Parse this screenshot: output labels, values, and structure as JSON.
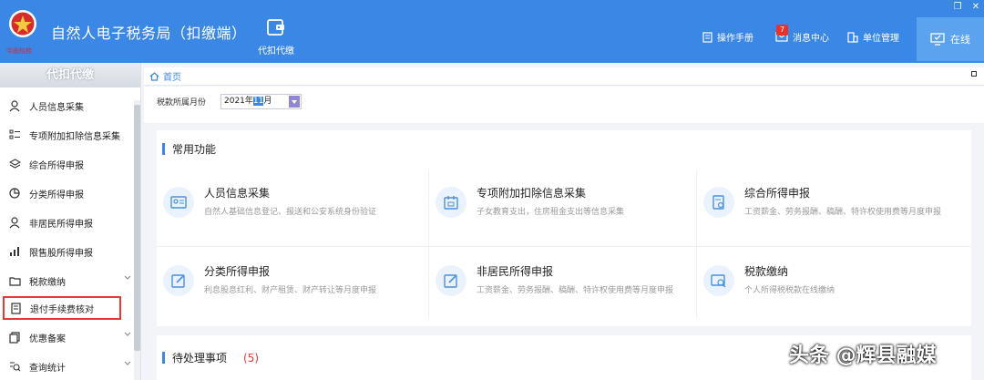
{
  "app": {
    "title": "自然人电子税务局（扣缴端）",
    "logo_text": "中國稅務"
  },
  "top_tab": {
    "label": "代扣代缴",
    "icon": "wallet-icon"
  },
  "topnav": {
    "manual": "操作手册",
    "messages": "消息中心",
    "message_count": "7",
    "unit": "单位管理",
    "online": "在线"
  },
  "sidebar": {
    "header": "代扣代缴",
    "items": [
      {
        "label": "人员信息采集",
        "icon": "person-icon"
      },
      {
        "label": "专项附加扣除信息采集",
        "icon": "list-icon"
      },
      {
        "label": "综合所得申报",
        "icon": "layers-icon"
      },
      {
        "label": "分类所得申报",
        "icon": "pie-icon"
      },
      {
        "label": "非居民所得申报",
        "icon": "person-icon"
      },
      {
        "label": "限售股所得申报",
        "icon": "bars-icon"
      },
      {
        "label": "税款缴纳",
        "icon": "folder-icon"
      },
      {
        "label": "退付手续费核对",
        "icon": "document-icon"
      },
      {
        "label": "优惠备案",
        "icon": "copy-icon"
      },
      {
        "label": "查询统计",
        "icon": "search-list-icon"
      }
    ]
  },
  "breadcrumb": {
    "home": "首页"
  },
  "filter": {
    "label": "税款所属月份",
    "year_part": "2021年",
    "month_selected": "11",
    "month_suffix": "月"
  },
  "common": {
    "title": "常用功能",
    "cards": [
      {
        "title": "人员信息采集",
        "desc": "自然人基础信息登记、报送和公安系统身份验证"
      },
      {
        "title": "专项附加扣除信息采集",
        "desc": "子女教育支出，住房租金支出等信息采集"
      },
      {
        "title": "综合所得申报",
        "desc": "工资薪金、劳务报酬、稿酬、特许权使用费等月度申报"
      },
      {
        "title": "分类所得申报",
        "desc": "利息股息红利、财产租赁、财产转让等月度申报"
      },
      {
        "title": "非居民所得申报",
        "desc": "工资薪金、劳务报酬、稿酬、特许权使用费等月度申报"
      },
      {
        "title": "税款缴纳",
        "desc": "个人所得税税款在线缴纳"
      }
    ]
  },
  "pending": {
    "title": "待处理事项",
    "count": "(5)"
  },
  "watermark": "头条 @辉县融媒",
  "colors": {
    "primary": "#3b87e6",
    "highlight_border": "#e53935"
  }
}
